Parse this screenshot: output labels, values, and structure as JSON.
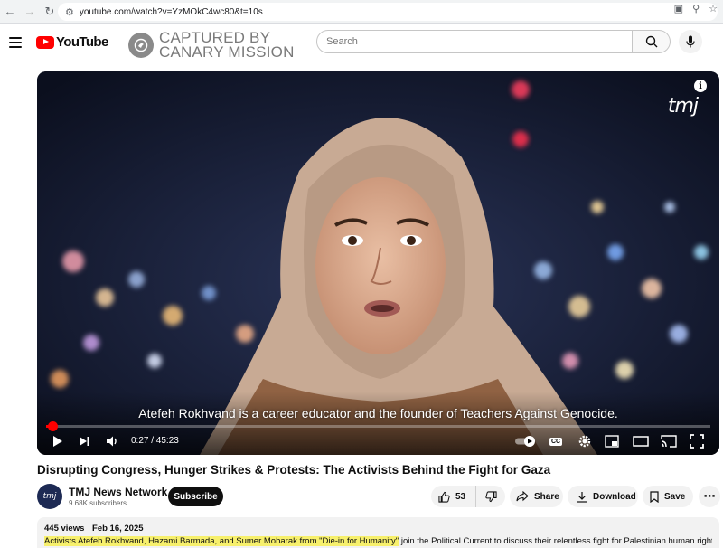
{
  "browser": {
    "url": "youtube.com/watch?v=YzMOkC4wc80&t=10s"
  },
  "header": {
    "logo_text": "YouTube",
    "watermark_line1": "CAPTURED BY",
    "watermark_line2": "CANARY MISSION",
    "search_placeholder": "Search"
  },
  "player": {
    "caption": "Atefeh Rokhvand is a career educator and the founder of Teachers Against Genocide.",
    "overlay_logo": "tmj",
    "time_current": "0:27",
    "time_total": "45:23",
    "time_display": "0:27 / 45:23",
    "progress_fraction": 0.0099,
    "cc_label": "CC"
  },
  "video": {
    "title": "Disrupting Congress, Hunger Strikes & Protests: The Activists Behind the Fight for Gaza",
    "channel_name": "TMJ News Network",
    "channel_avatar_text": "tmj",
    "subscribers": "9.68K subscribers",
    "subscribe_label": "Subscribe",
    "likes": "53",
    "share_label": "Share",
    "download_label": "Download",
    "save_label": "Save"
  },
  "description": {
    "views": "445 views",
    "date": "Feb 16, 2025",
    "highlighted": "Activists Atefeh Rokhvand, Hazami Barmada, and Sumer Mobarak from \"Die-in for Humanity\"",
    "rest": " join the Political Current to discuss their relentless fight for Palestinian human rights in"
  },
  "colors": {
    "brand_red": "#ff0000",
    "highlight": "#f7f06c"
  }
}
